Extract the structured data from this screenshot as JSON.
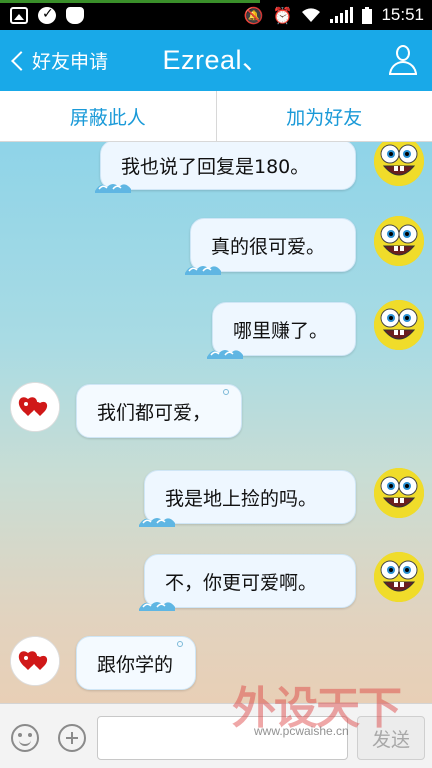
{
  "status_bar": {
    "time": "15:51",
    "icons": [
      "gallery-icon",
      "check-circle-icon",
      "shield-icon",
      "mute-icon",
      "alarm-icon",
      "wifi-icon",
      "signal-icon",
      "battery-icon"
    ]
  },
  "header": {
    "back_label": "好友申请",
    "title": "Ezreal、",
    "profile_icon": "person-icon",
    "background_color": "#19a9e8"
  },
  "actions": {
    "block_label": "屏蔽此人",
    "add_friend_label": "加为好友",
    "accent_color": "#1a9ad8"
  },
  "messages": [
    {
      "side": "sent",
      "text": "我也说了回复是180。"
    },
    {
      "side": "sent",
      "text": "真的很可爱。"
    },
    {
      "side": "sent",
      "text": "哪里赚了。"
    },
    {
      "side": "received",
      "text": "我们都可爱，"
    },
    {
      "side": "sent",
      "text": "我是地上捡的吗。"
    },
    {
      "side": "sent",
      "text": "不，你更可爱啊。"
    },
    {
      "side": "received",
      "text": "跟你学的"
    }
  ],
  "input_bar": {
    "placeholder": "",
    "send_label": "发送"
  },
  "watermark": {
    "brand": "外设天下",
    "url": "www.pcwaishe.cn"
  }
}
